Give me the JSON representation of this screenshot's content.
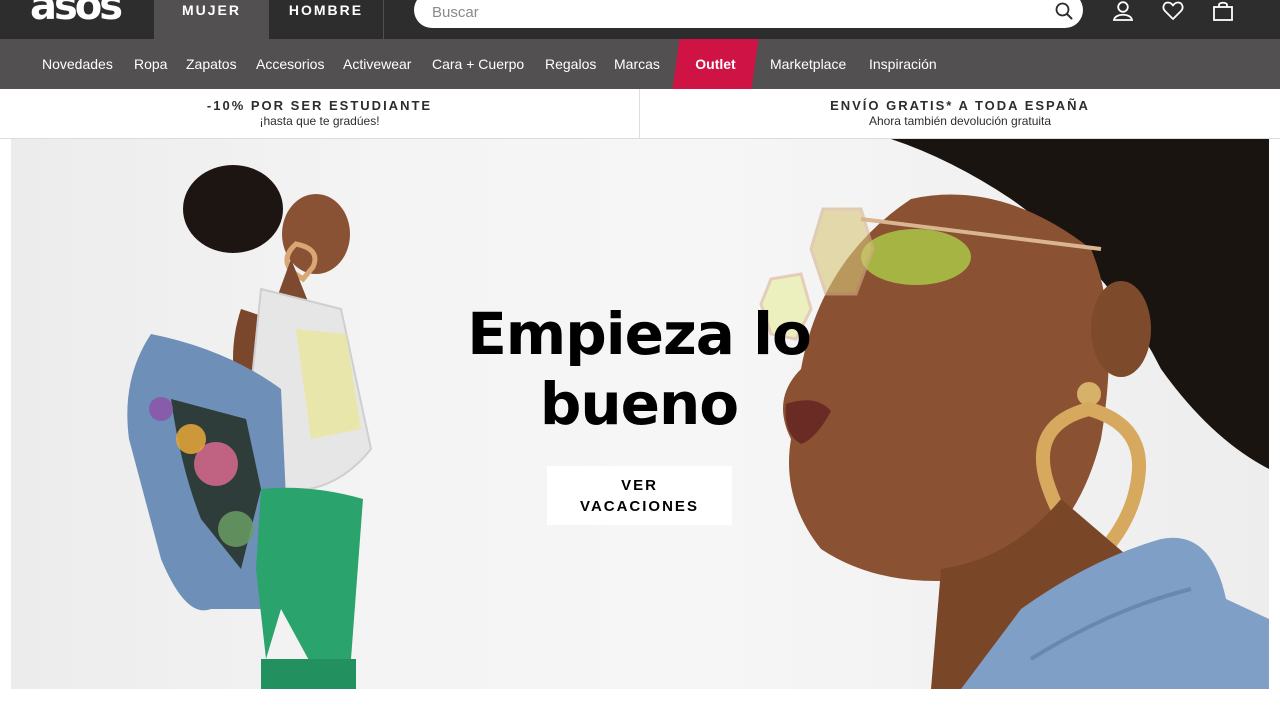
{
  "header": {
    "logo": "asos",
    "tabs": [
      {
        "label": "MUJER",
        "active": true
      },
      {
        "label": "HOMBRE",
        "active": false
      }
    ],
    "search": {
      "placeholder": "Buscar",
      "value": ""
    },
    "icons": [
      "search-icon",
      "account-icon",
      "heart-icon",
      "bag-icon"
    ]
  },
  "nav": {
    "items": [
      "Novedades",
      "Ropa",
      "Zapatos",
      "Accesorios",
      "Activewear",
      "Cara + Cuerpo",
      "Regalos",
      "Marcas"
    ],
    "outlet": "Outlet",
    "after": [
      "Marketplace",
      "Inspiración"
    ]
  },
  "promo": {
    "left": {
      "title": "-10% POR SER ESTUDIANTE",
      "subtitle": "¡hasta que te gradúes!"
    },
    "right": {
      "title": "ENVÍO GRATIS* A TODA ESPAÑA",
      "subtitle": "Ahora también devolución gratuita"
    }
  },
  "hero": {
    "title_line1": "Empieza lo",
    "title_line2": "bueno",
    "cta_line1": "VER",
    "cta_line2": "VACACIONES"
  },
  "colors": {
    "topbar": "#2d2d2d",
    "nav": "#525050",
    "outlet": "#d01345"
  }
}
